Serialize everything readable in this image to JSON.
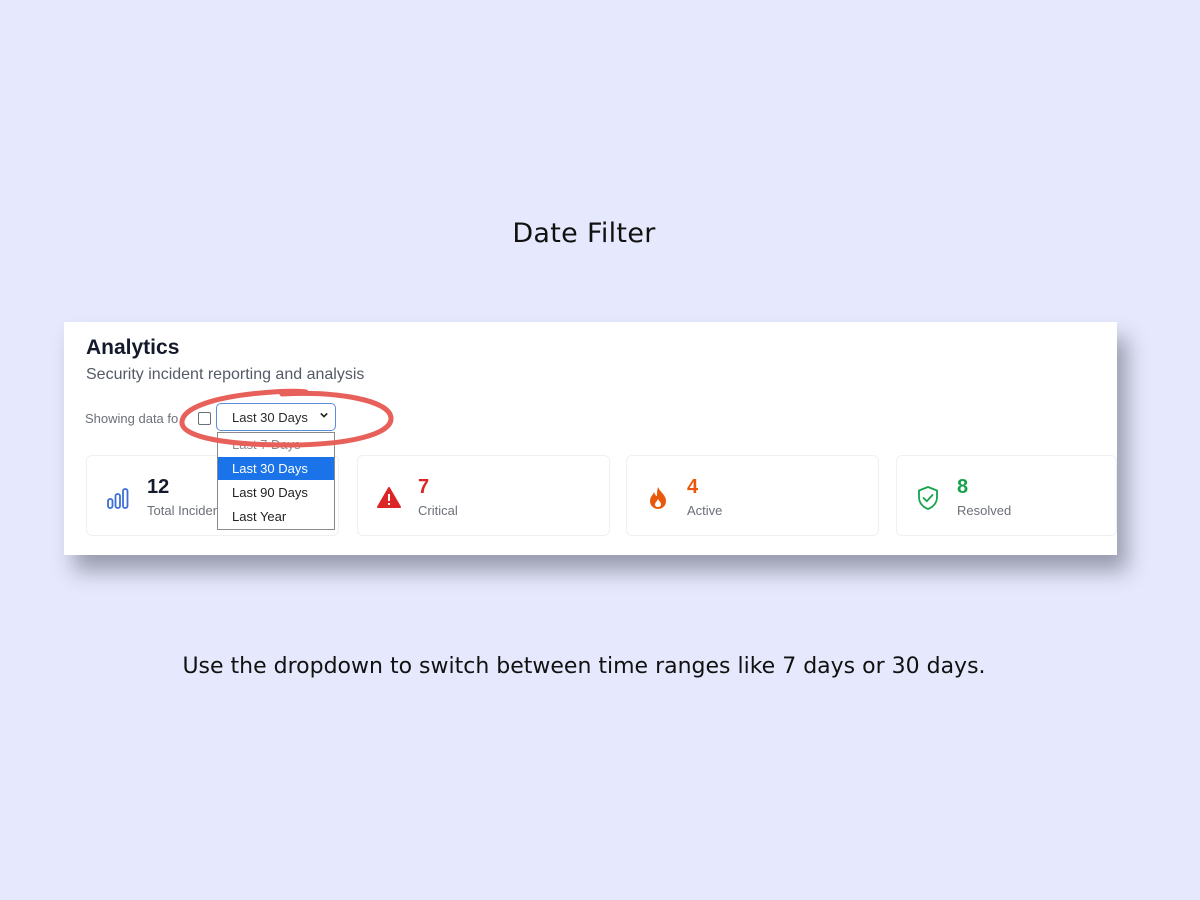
{
  "slide": {
    "title": "Date Filter",
    "caption": "Use the dropdown to switch between time ranges like 7 days or 30 days."
  },
  "panel": {
    "title": "Analytics",
    "subtitle": "Security incident reporting and analysis",
    "filter": {
      "label": "Showing data fo",
      "selected": "Last 30 Days",
      "options": [
        "Last 7 Days",
        "Last 30 Days",
        "Last 90 Days",
        "Last Year"
      ]
    },
    "cards": [
      {
        "value": "12",
        "label": "Total Incidents",
        "icon": "bar-chart-icon",
        "color": "#141a2b"
      },
      {
        "value": "7",
        "label": "Critical",
        "icon": "warning-icon",
        "color": "#dc2626"
      },
      {
        "value": "4",
        "label": "Active",
        "icon": "fire-icon",
        "color": "#ea580c"
      },
      {
        "value": "8",
        "label": "Resolved",
        "icon": "shield-check-icon",
        "color": "#16a34a"
      }
    ]
  },
  "colors": {
    "background": "#e6e9fd",
    "highlight": "#e8605a",
    "accent": "#1a73e8"
  }
}
